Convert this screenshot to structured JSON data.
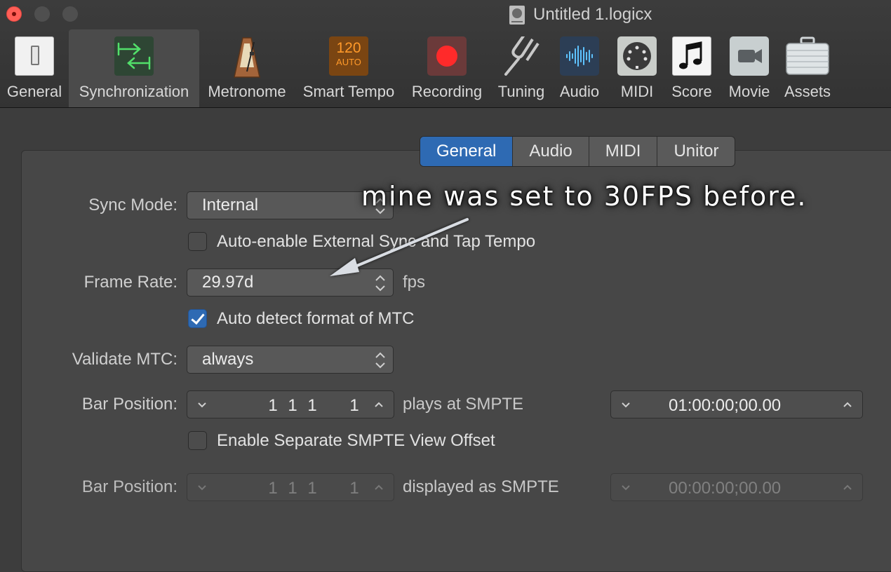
{
  "window": {
    "title": "Untitled 1.logicx"
  },
  "toolbar": {
    "items": [
      {
        "label": "General",
        "icon": "switch-icon"
      },
      {
        "label": "Synchronization",
        "icon": "sync-arrows-icon",
        "selected": true
      },
      {
        "label": "Metronome",
        "icon": "metronome-icon"
      },
      {
        "label": "Smart Tempo",
        "icon": "smart-tempo-icon",
        "badge_top": "120",
        "badge_bottom": "AUTO"
      },
      {
        "label": "Recording",
        "icon": "record-icon"
      },
      {
        "label": "Tuning",
        "icon": "tuning-fork-icon"
      },
      {
        "label": "Audio",
        "icon": "waveform-icon"
      },
      {
        "label": "MIDI",
        "icon": "midi-port-icon"
      },
      {
        "label": "Score",
        "icon": "music-note-icon"
      },
      {
        "label": "Movie",
        "icon": "video-camera-icon"
      },
      {
        "label": "Assets",
        "icon": "briefcase-icon"
      }
    ]
  },
  "tabs": [
    {
      "label": "General",
      "active": true
    },
    {
      "label": "Audio"
    },
    {
      "label": "MIDI"
    },
    {
      "label": "Unitor"
    }
  ],
  "form": {
    "sync_mode": {
      "label": "Sync Mode:",
      "value": "Internal"
    },
    "auto_enable": {
      "label": "Auto-enable External Sync and Tap Tempo",
      "checked": false
    },
    "frame_rate": {
      "label": "Frame Rate:",
      "value": "29.97d",
      "unit": "fps"
    },
    "auto_detect": {
      "label": "Auto detect format of MTC",
      "checked": true
    },
    "validate_mtc": {
      "label": "Validate MTC:",
      "value": "always"
    },
    "bar_position_1": {
      "label": "Bar Position:",
      "bar": [
        "1",
        "1",
        "1",
        "1"
      ],
      "between": "plays at SMPTE",
      "smpte": "01:00:00;00.00"
    },
    "separate_offset": {
      "label": "Enable Separate SMPTE View Offset",
      "checked": false
    },
    "bar_position_2": {
      "label": "Bar Position:",
      "bar": [
        "1",
        "1",
        "1",
        "1"
      ],
      "between": "displayed as SMPTE",
      "smpte": "00:00:00;00.00",
      "disabled": true
    }
  },
  "annotation": {
    "text": "mine was set to 30FPS before.",
    "color": "#ffffff"
  },
  "colors": {
    "accent": "#2e6ab3",
    "close_button": "#ff5f57",
    "record": "#ff2a2a",
    "smart_tempo": "#ff9a2a"
  }
}
